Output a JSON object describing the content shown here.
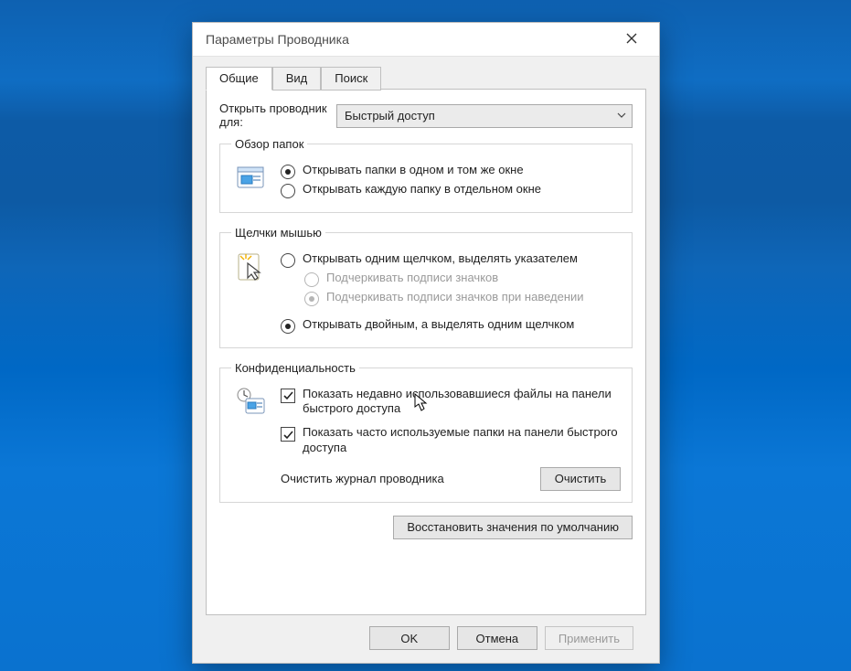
{
  "window": {
    "title": "Параметры Проводника"
  },
  "tabs": [
    {
      "label": "Общие",
      "active": true
    },
    {
      "label": "Вид",
      "active": false
    },
    {
      "label": "Поиск",
      "active": false
    }
  ],
  "open": {
    "label": "Открыть проводник для:",
    "value": "Быстрый доступ"
  },
  "browse": {
    "legend": "Обзор папок",
    "options": [
      {
        "label": "Открывать папки в одном и том же окне",
        "checked": true
      },
      {
        "label": "Открывать каждую папку в отдельном окне",
        "checked": false
      }
    ]
  },
  "click": {
    "legend": "Щелчки мышью",
    "options": [
      {
        "label": "Открывать одним щелчком, выделять указателем",
        "checked": false,
        "disabled": false,
        "indent": false
      },
      {
        "label": "Подчеркивать подписи значков",
        "checked": false,
        "disabled": true,
        "indent": true
      },
      {
        "label": "Подчеркивать подписи значков при наведении",
        "checked": true,
        "disabled": true,
        "indent": true
      },
      {
        "label": "Открывать двойным, а выделять одним щелчком",
        "checked": true,
        "disabled": false,
        "indent": false
      }
    ]
  },
  "privacy": {
    "legend": "Конфиденциальность",
    "checks": [
      {
        "label": "Показать недавно использовавшиеся файлы на панели быстрого доступа",
        "checked": true
      },
      {
        "label": "Показать часто используемые папки на панели быстрого доступа",
        "checked": true
      }
    ],
    "clear_label": "Очистить журнал проводника",
    "clear_button": "Очистить"
  },
  "restore": {
    "button": "Восстановить значения по умолчанию"
  },
  "footer": {
    "ok": "OK",
    "cancel": "Отмена",
    "apply": "Применить"
  }
}
